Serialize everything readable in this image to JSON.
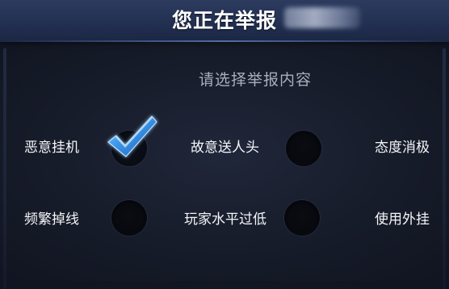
{
  "header": {
    "title": "您正在举报"
  },
  "subtitle": "请选择举报内容",
  "options": [
    {
      "label": "恶意挂机",
      "checked": true
    },
    {
      "label": "故意送人头",
      "checked": false
    },
    {
      "label": "态度消极",
      "checked": false
    },
    {
      "label": "频繁掉线",
      "checked": false
    },
    {
      "label": "玩家水平过低",
      "checked": false
    },
    {
      "label": "使用外挂",
      "checked": false
    }
  ],
  "colors": {
    "header": "#223052",
    "background": "#171c2a",
    "check": "#3b94e8",
    "subtitle": "#a8aebd"
  },
  "icons": {
    "checked": "checkmark-icon"
  }
}
